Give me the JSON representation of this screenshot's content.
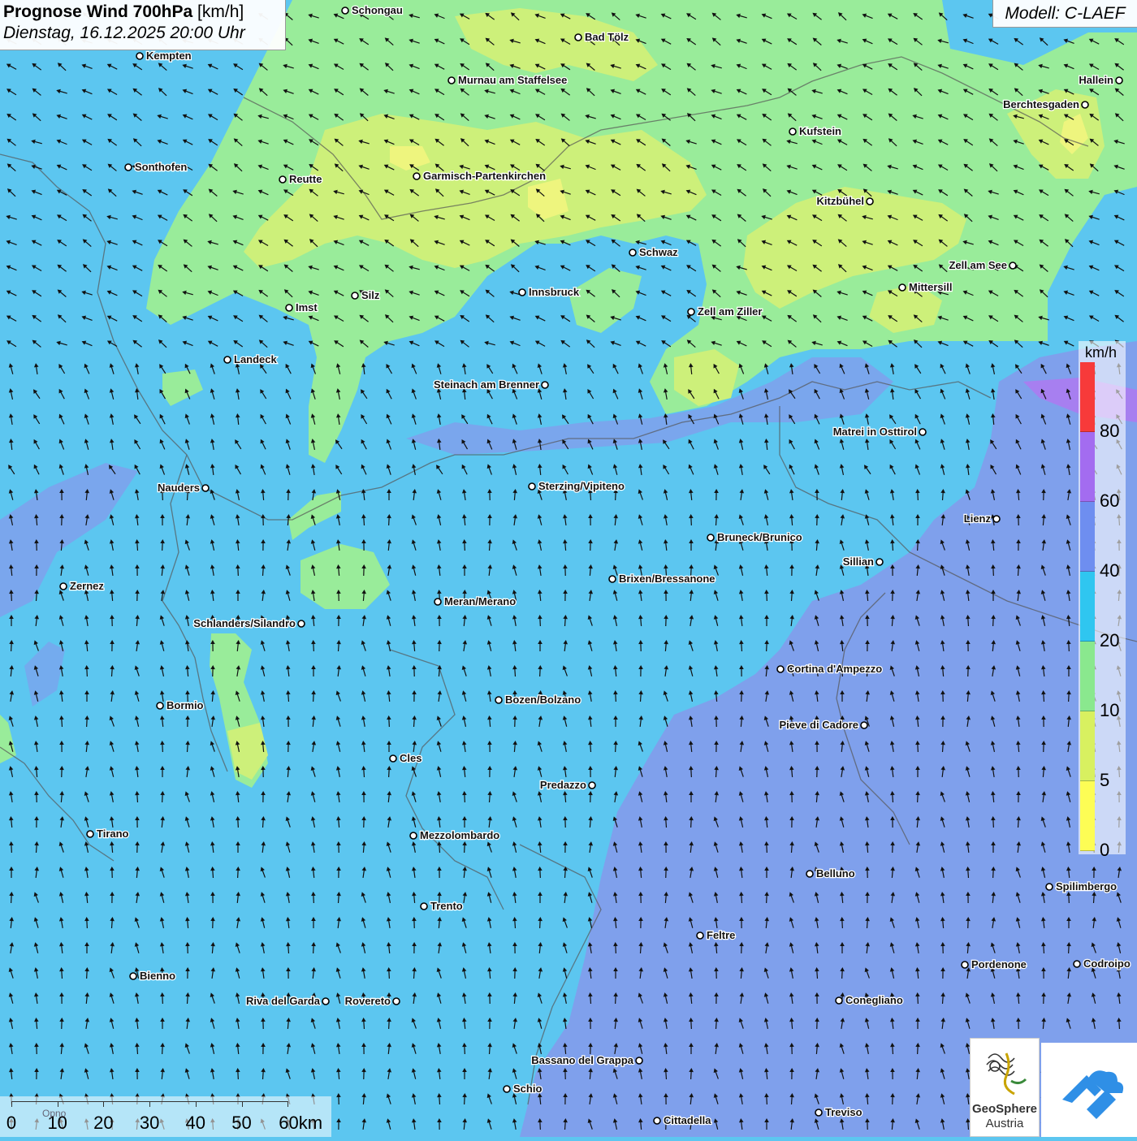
{
  "title": {
    "main": "Prognose Wind 700hPa",
    "unit": "[km/h]",
    "datetime": "Dienstag, 16.12.2025 20:00 Uhr"
  },
  "model": "Modell: C-LAEF",
  "legend": {
    "unit": "km/h",
    "labels": [
      "80",
      "60",
      "40",
      "20",
      "10",
      "5",
      "0"
    ],
    "colors": [
      "#f73a3a",
      "#a36cf0",
      "#6e8ef0",
      "#2fc6f0",
      "#8ae88e",
      "#d8f060",
      "#fdfd55"
    ]
  },
  "scale_bar": {
    "labels": [
      "0",
      "10",
      "20",
      "30",
      "40",
      "50",
      "60km"
    ],
    "annotation": "Opno"
  },
  "logo": {
    "name_line1": "GeoSphere",
    "name_line2": "Austria"
  },
  "icons": [
    "geosphere-logo-icon",
    "cloud-brand-icon",
    "city-marker-icon",
    "wind-arrow-icon"
  ],
  "cities": [
    {
      "name": "Schongau",
      "anchor": "left"
    },
    {
      "name": "Bad Tölz",
      "anchor": "left"
    },
    {
      "name": "Kempten",
      "anchor": "left"
    },
    {
      "name": "Murnau am Staffelsee",
      "anchor": "left"
    },
    {
      "name": "Hallein",
      "anchor": "right"
    },
    {
      "name": "Berchtesgaden",
      "anchor": "right"
    },
    {
      "name": "Kufstein",
      "anchor": "left"
    },
    {
      "name": "Sonthofen",
      "anchor": "left"
    },
    {
      "name": "Reutte",
      "anchor": "left"
    },
    {
      "name": "Garmisch-Partenkirchen",
      "anchor": "left"
    },
    {
      "name": "Kitzbühel",
      "anchor": "right"
    },
    {
      "name": "Schwaz",
      "anchor": "left"
    },
    {
      "name": "Zell am See",
      "anchor": "right"
    },
    {
      "name": "Innsbruck",
      "anchor": "left"
    },
    {
      "name": "Mittersill",
      "anchor": "left"
    },
    {
      "name": "Silz",
      "anchor": "left"
    },
    {
      "name": "Imst",
      "anchor": "left"
    },
    {
      "name": "Zell am Ziller",
      "anchor": "left"
    },
    {
      "name": "Landeck",
      "anchor": "left"
    },
    {
      "name": "Steinach am Brenner",
      "anchor": "right"
    },
    {
      "name": "Matrei in Osttirol",
      "anchor": "right"
    },
    {
      "name": "Nauders",
      "anchor": "right"
    },
    {
      "name": "Sterzing/Vipiteno",
      "anchor": "left"
    },
    {
      "name": "Lienz",
      "anchor": "right"
    },
    {
      "name": "Bruneck/Brunico",
      "anchor": "left"
    },
    {
      "name": "Sillian",
      "anchor": "right"
    },
    {
      "name": "Brixen/Bressanone",
      "anchor": "left"
    },
    {
      "name": "Zernez",
      "anchor": "left"
    },
    {
      "name": "Meran/Merano",
      "anchor": "left"
    },
    {
      "name": "Schlanders/Silandro",
      "anchor": "right"
    },
    {
      "name": "Cortina d'Ampezzo",
      "anchor": "left"
    },
    {
      "name": "Bozen/Bolzano",
      "anchor": "left"
    },
    {
      "name": "Bormio",
      "anchor": "left"
    },
    {
      "name": "Pieve di Cadore",
      "anchor": "right"
    },
    {
      "name": "Cles",
      "anchor": "left"
    },
    {
      "name": "Predazzo",
      "anchor": "right"
    },
    {
      "name": "Tirano",
      "anchor": "left"
    },
    {
      "name": "Mezzolombardo",
      "anchor": "left"
    },
    {
      "name": "Belluno",
      "anchor": "left"
    },
    {
      "name": "Spilimbergo",
      "anchor": "left"
    },
    {
      "name": "Trento",
      "anchor": "left"
    },
    {
      "name": "Feltre",
      "anchor": "left"
    },
    {
      "name": "Pordenone",
      "anchor": "left"
    },
    {
      "name": "Codroipo",
      "anchor": "left"
    },
    {
      "name": "Bienno",
      "anchor": "left"
    },
    {
      "name": "Riva del Garda",
      "anchor": "right"
    },
    {
      "name": "Rovereto",
      "anchor": "right"
    },
    {
      "name": "Conegliano",
      "anchor": "left"
    },
    {
      "name": "Bassano del Grappa",
      "anchor": "right"
    },
    {
      "name": "Schio",
      "anchor": "left"
    },
    {
      "name": "Treviso",
      "anchor": "left"
    },
    {
      "name": "Cittadella",
      "anchor": "left"
    }
  ]
}
